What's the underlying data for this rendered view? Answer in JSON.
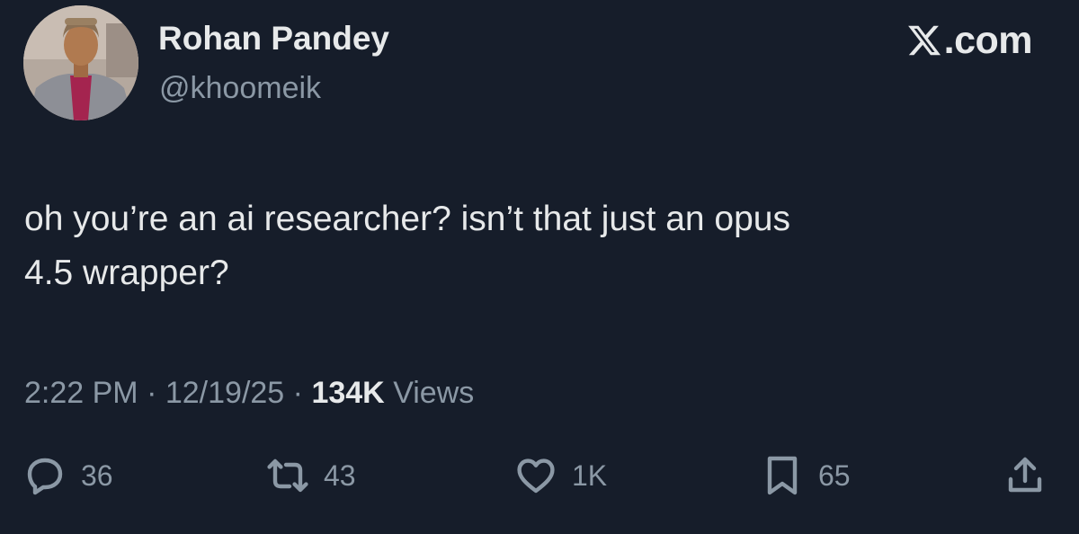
{
  "author": {
    "name": "Rohan Pandey",
    "handle": "@khoomeik"
  },
  "brand": {
    "text": ".com",
    "logo_icon": "x-logo-icon"
  },
  "tweet": {
    "lines": [
      "oh you’re an ai researcher? isn’t that just an opus",
      "4.5 wrapper?"
    ]
  },
  "meta": {
    "time": "2:22 PM",
    "separator": "·",
    "date": "12/19/25",
    "views_count": "134K",
    "views_label": "Views"
  },
  "actions": {
    "replies": "36",
    "retweets": "43",
    "likes": "1K",
    "bookmarks": "65"
  },
  "colors": {
    "background": "#161d2a",
    "text_primary": "#e7e9ea",
    "text_secondary": "#8b98a5"
  }
}
